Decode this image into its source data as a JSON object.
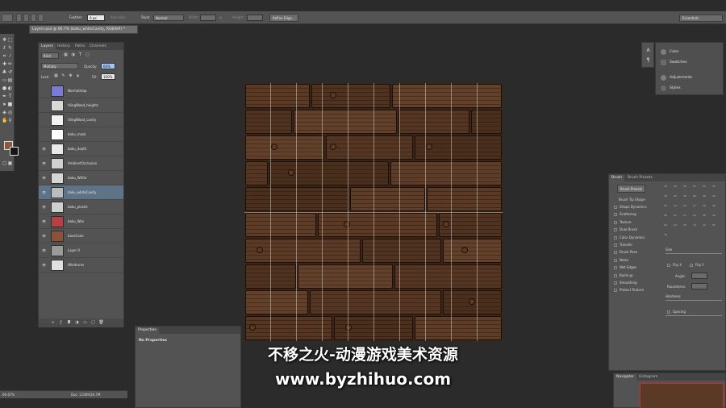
{
  "options_bar": {
    "feather_label": "Feather:",
    "feather_value": "0 px",
    "anti_alias_label": "Anti-alias",
    "style_label": "Style:",
    "style_value": "Normal",
    "width_label": "Width:",
    "height_label": "Height:",
    "refine_edge_label": "Refine Edge...",
    "workspace_value": "Essentials"
  },
  "document_tab": {
    "title": "Layers.psd @ 66.7% (baku_whiteCavity, RGB/8#) *"
  },
  "layers_panel": {
    "tabs": [
      "Layers",
      "History",
      "Paths",
      "Channels"
    ],
    "active_tab": "Layers",
    "kind_value": "Kind",
    "blend_mode": "Multiply",
    "opacity_label": "Opacity:",
    "opacity_value": "60%",
    "lock_label": "Lock:",
    "fill_label": "Fill:",
    "fill_value": "100%",
    "layers": [
      {
        "name": "Normalmap",
        "thumb_color": "#7b7bd6",
        "visible": false,
        "selected": false
      },
      {
        "name": "tilingWood_heights",
        "thumb_color": "#d9d9d9",
        "visible": false,
        "selected": false
      },
      {
        "name": "tilingWood_cavity",
        "thumb_color": "#f2f2f2",
        "visible": false,
        "selected": false
      },
      {
        "name": "baku_mask",
        "thumb_color": "#ffffff",
        "visible": false,
        "selected": false
      },
      {
        "name": "baku_depth",
        "thumb_color": "#e8e8e8",
        "visible": true,
        "selected": false
      },
      {
        "name": "AmbientOcclusion",
        "thumb_color": "#cfcfcf",
        "visible": true,
        "selected": false
      },
      {
        "name": "baku_White",
        "thumb_color": "#d6d6d6",
        "visible": true,
        "selected": false
      },
      {
        "name": "baku_whiteCavity",
        "thumb_color": "#bcbcbc",
        "visible": true,
        "selected": true
      },
      {
        "name": "baku_plastic",
        "thumb_color": "#cfcfcf",
        "visible": true,
        "selected": false
      },
      {
        "name": "baku_Wax",
        "thumb_color": "#b54242",
        "visible": true,
        "selected": false
      },
      {
        "name": "baseColor",
        "thumb_color": "#8a5238",
        "visible": true,
        "selected": false
      },
      {
        "name": "Layer 0",
        "thumb_color": "#9a9a9a",
        "visible": true,
        "selected": false
      },
      {
        "name": "Windrums",
        "thumb_color": "#e0e0e0",
        "visible": true,
        "selected": false
      }
    ]
  },
  "right_panels": {
    "color_label": "Color",
    "swatches_label": "Swatches",
    "adjustments_label": "Adjustments",
    "styles_label": "Styles"
  },
  "brush_panel": {
    "tabs": [
      "Brush",
      "Brush Presets"
    ],
    "presets_button": "Brush Presets",
    "tip_shape_label": "Brush Tip Shape",
    "options": [
      "Shape Dynamics",
      "Scattering",
      "Texture",
      "Dual Brush",
      "Color Dynamics",
      "Transfer",
      "Brush Pose",
      "Noise",
      "Wet Edges",
      "Build-up",
      "Smoothing",
      "Protect Texture"
    ],
    "size_label": "Size",
    "flip_x_label": "Flip X",
    "flip_y_label": "Flip Y",
    "angle_label": "Angle:",
    "roundness_label": "Roundness:",
    "hardness_label": "Hardness",
    "spacing_label": "Spacing",
    "tip_sizes": [
      "30",
      "30",
      "30",
      "25",
      "25",
      "25",
      "36",
      "25",
      "36",
      "36",
      "36",
      "32",
      "25",
      "14",
      "24",
      "27",
      "39",
      "46",
      "59",
      "11",
      "17",
      "23",
      "36",
      "44",
      "60",
      "14",
      "26",
      "33",
      "42",
      "55",
      "70"
    ]
  },
  "navigator_panel": {
    "tabs": [
      "Navigator",
      "Histogram"
    ]
  },
  "properties_panel": {
    "title": "Properties",
    "body": "No Properties"
  },
  "status_bar": {
    "zoom": "66.67%",
    "doc": "Doc: 3.00M/36.7M"
  },
  "watermark": {
    "line1": "不移之火-动漫游戏美术资源",
    "line2": "www.byzhihuo.com"
  }
}
